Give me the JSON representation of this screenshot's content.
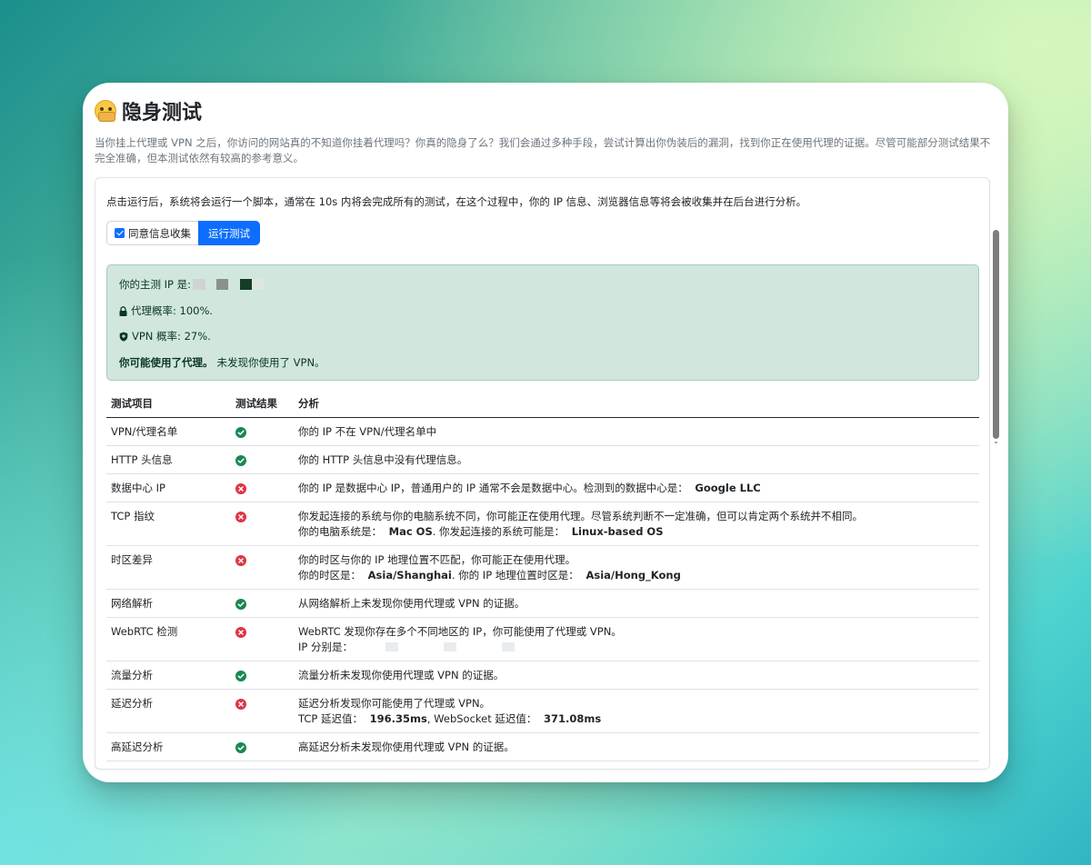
{
  "page": {
    "title": "隐身测试",
    "description": "当你挂上代理或 VPN 之后，你访问的网站真的不知道你挂着代理吗？你真的隐身了么？我们会通过多种手段，尝试计算出你伪装后的漏洞，找到你正在使用代理的证据。尽管可能部分测试结果不完全准确，但本测试依然有较高的参考意义。"
  },
  "card": {
    "intro": "点击运行后，系统将会运行一个脚本，通常在 10s 内将会完成所有的测试，在这个过程中，你的 IP 信息、浏览器信息等将会被收集并在后台进行分析。",
    "consent_label": "同意信息收集",
    "consent_checked": true,
    "run_button": "运行测试"
  },
  "summary": {
    "main_ip_label": "你的主测 IP 是:",
    "proxy_prob": "代理概率: 100%.",
    "vpn_prob": "VPN 概率: 27%.",
    "conclusion_bold": "你可能使用了代理。",
    "conclusion_rest": "未发现你使用了 VPN。"
  },
  "table": {
    "headers": [
      "测试项目",
      "测试结果",
      "分析"
    ],
    "rows": [
      {
        "item": "VPN/代理名单",
        "status": "pass",
        "line1": "你的 IP 不在 VPN/代理名单中"
      },
      {
        "item": "HTTP 头信息",
        "status": "pass",
        "line1": "你的 HTTP 头信息中没有代理信息。"
      },
      {
        "item": "数据中心 IP",
        "status": "fail",
        "line1": "你的 IP 是数据中心 IP，普通用户的 IP 通常不会是数据中心。检测到的数据中心是：",
        "line1_bold": "Google LLC"
      },
      {
        "item": "TCP 指纹",
        "status": "fail",
        "line1": "你发起连接的系统与你的电脑系统不同，你可能正在使用代理。尽管系统判断不一定准确，但可以肯定两个系统并不相同。",
        "line2a": "你的电脑系统是：",
        "line2a_bold": "Mac OS",
        "line2b": ". 你发起连接的系统可能是：",
        "line2b_bold": "Linux-based OS"
      },
      {
        "item": "时区差异",
        "status": "fail",
        "line1": "你的时区与你的 IP 地理位置不匹配，你可能正在使用代理。",
        "line2a": "你的时区是：",
        "line2a_bold": "Asia/Shanghai",
        "line2b": ". 你的 IP 地理位置时区是：",
        "line2b_bold": "Asia/Hong_Kong"
      },
      {
        "item": "网络解析",
        "status": "pass",
        "line1": "从网络解析上未发现你使用代理或 VPN 的证据。"
      },
      {
        "item": "WebRTC 检测",
        "status": "fail",
        "line1": "WebRTC 发现你存在多个不同地区的 IP，你可能使用了代理或 VPN。",
        "line2a": "IP 分别是："
      },
      {
        "item": "流量分析",
        "status": "pass",
        "line1": "流量分析未发现你使用代理或 VPN 的证据。"
      },
      {
        "item": "延迟分析",
        "status": "fail",
        "line1": "延迟分析发现你可能使用了代理或 VPN。",
        "line2a": "TCP 延迟值：",
        "line2a_bold": "196.35ms",
        "line2b": ", WebSocket 延迟值：",
        "line2b_bold": "371.08ms"
      },
      {
        "item": "高延迟分析",
        "status": "pass",
        "line1": "高延迟分析未发现你使用代理或 VPN 的证据。"
      }
    ]
  },
  "colors": {
    "pass": "#198754",
    "fail": "#dc3545",
    "primary": "#0d6efd",
    "alert_bg": "#d1e7dd"
  },
  "icons": {
    "pass": "check-circle-icon",
    "fail": "x-circle-icon",
    "proxy": "lock-icon",
    "vpn": "shield-icon",
    "title": "shushing-face-emoji"
  }
}
